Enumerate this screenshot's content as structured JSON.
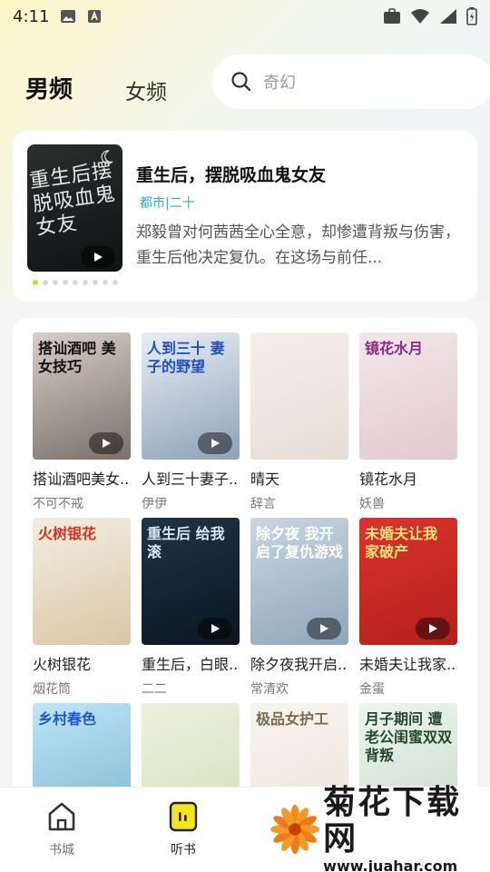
{
  "status_bar": {
    "time": "4:11"
  },
  "header": {
    "tab_male": "男频",
    "tab_female": "女频",
    "search_placeholder": "奇幻"
  },
  "featured": {
    "cover_text": "重生后摆脱吸血鬼女友",
    "title": "重生后，摆脱吸血鬼女友",
    "tag": "都市|二十",
    "description": "郑毅曾对何茜茜全心全意，却惨遭背叛与伤害，重生后他决定复仇。在这场与前任...",
    "carousel_count": 9,
    "carousel_active": 0
  },
  "books": [
    {
      "title": "搭讪酒吧美女...",
      "author": "不可不戒",
      "cover_text": "搭讪酒吧 美女技巧",
      "cover_colors": [
        "#d8cfc6",
        "#7c6f6a"
      ],
      "cover_text_color": "#111",
      "has_play": true
    },
    {
      "title": "人到三十妻子...",
      "author": "伊伊",
      "cover_text": "人到三十 妻子的野望",
      "cover_colors": [
        "#e9eef4",
        "#8ea1b8"
      ],
      "cover_text_color": "#1e4fbf",
      "has_play": true
    },
    {
      "title": "晴天",
      "author": "辞言",
      "cover_text": "",
      "cover_colors": [
        "#f5f0ec",
        "#e7dcd5"
      ],
      "cover_text_color": "#c0222a",
      "has_play": false
    },
    {
      "title": "镜花水月",
      "author": "妖兽",
      "cover_text": "镜花水月",
      "cover_colors": [
        "#f3e7e9",
        "#e2c9cf"
      ],
      "cover_text_color": "#8c2a8a",
      "has_play": false
    },
    {
      "title": "火树银花",
      "author": "烟花筒",
      "cover_text": "火树银花",
      "cover_colors": [
        "#f3ede0",
        "#d9c7a6"
      ],
      "cover_text_color": "#d8321d",
      "has_play": false
    },
    {
      "title": "重生后，白眼...",
      "author": "二二",
      "cover_text": "重生后 给我滚",
      "cover_colors": [
        "#1f3347",
        "#0b1620"
      ],
      "cover_text_color": "#d7e6f2",
      "has_play": true
    },
    {
      "title": "除夕夜我开启...",
      "author": "常清欢",
      "cover_text": "除夕夜 我开启了复仇游戏",
      "cover_colors": [
        "#c9d6e2",
        "#8fa6bb"
      ],
      "cover_text_color": "#ffffff",
      "has_play": true
    },
    {
      "title": "未婚夫让我家...",
      "author": "金蛋",
      "cover_text": "未婚夫让我 家破产",
      "cover_colors": [
        "#d9342c",
        "#b51f1c"
      ],
      "cover_text_color": "#ffe27a",
      "has_play": true
    },
    {
      "title": "",
      "author": "",
      "cover_text": "乡村春色",
      "cover_colors": [
        "#bfe5f6",
        "#7fb5d2"
      ],
      "cover_text_color": "#1a58c9",
      "has_play": false
    },
    {
      "title": "",
      "author": "",
      "cover_text": "",
      "cover_colors": [
        "#eef1df",
        "#d5dfb8"
      ],
      "cover_text_color": "#333",
      "has_play": false
    },
    {
      "title": "",
      "author": "",
      "cover_text": "极品女护工",
      "cover_colors": [
        "#f7f4ef",
        "#ece5da"
      ],
      "cover_text_color": "#7b6a4a",
      "has_play": false
    },
    {
      "title": "",
      "author": "",
      "cover_text": "月子期间 遭老公闺蜜双双背叛",
      "cover_colors": [
        "#eef4ee",
        "#c9dccb"
      ],
      "cover_text_color": "#244a2a",
      "has_play": false
    }
  ],
  "bottom_nav": {
    "items": [
      {
        "label": "书城",
        "active": false
      },
      {
        "label": "听书",
        "active": true
      }
    ]
  },
  "watermark": {
    "name": "菊花下载网",
    "url": "www.juahar.com"
  },
  "colors": {
    "accent": "#f3c51d",
    "tag": "#35a9c8"
  }
}
